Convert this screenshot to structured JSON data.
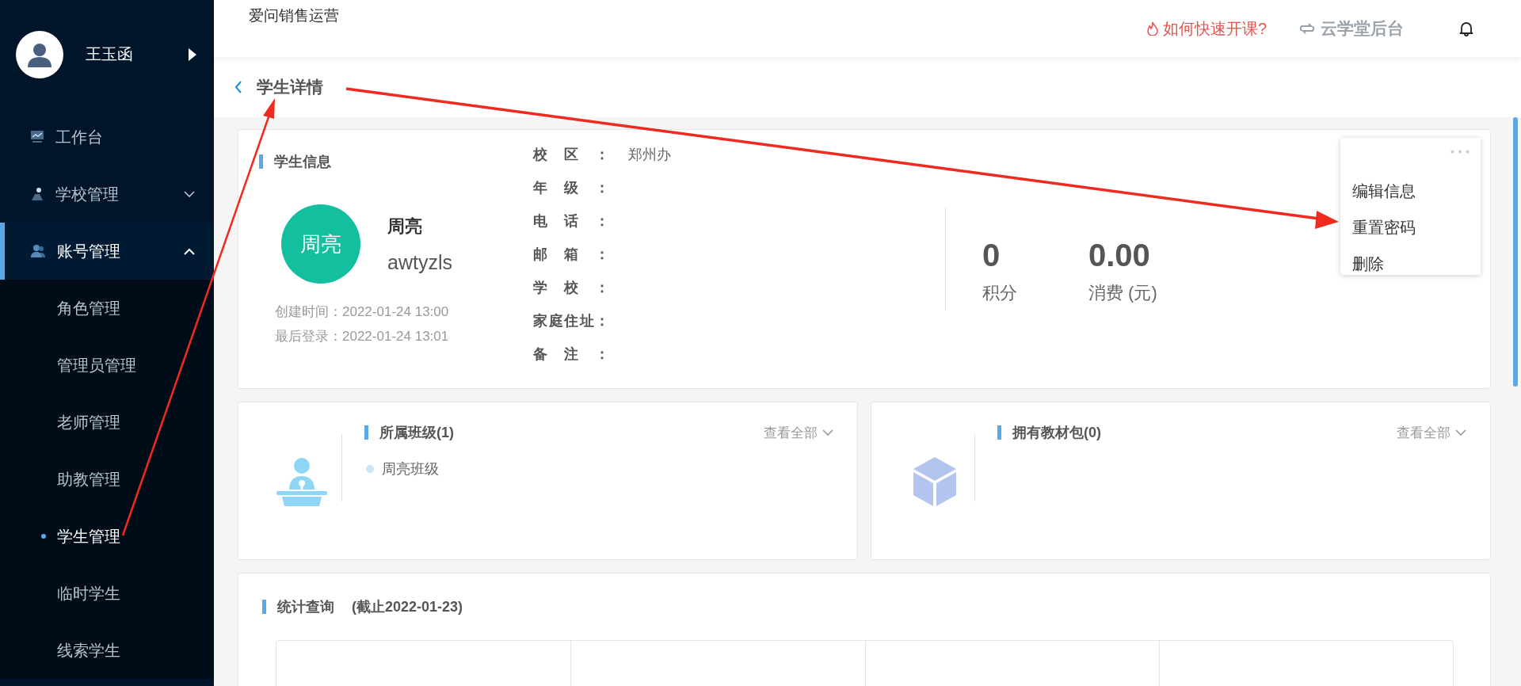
{
  "sidebar": {
    "user_name": "王玉函",
    "items": [
      {
        "label": "工作台",
        "selected": false
      },
      {
        "label": "学校管理",
        "selected": false,
        "expanded": false
      },
      {
        "label": "账号管理",
        "selected": true,
        "expanded": true,
        "children": [
          {
            "label": "角色管理",
            "selected": false
          },
          {
            "label": "管理员管理",
            "selected": false
          },
          {
            "label": "老师管理",
            "selected": false
          },
          {
            "label": "助教管理",
            "selected": false
          },
          {
            "label": "学生管理",
            "selected": true
          },
          {
            "label": "临时学生",
            "selected": false
          },
          {
            "label": "线索学生",
            "selected": false
          }
        ]
      }
    ]
  },
  "header": {
    "title": "爱问销售运营",
    "help_link": "如何快速开课?",
    "backend_link": "云学堂后台"
  },
  "page": {
    "title": "学生详情"
  },
  "student_info": {
    "section_title": "学生信息",
    "avatar_text": "周亮",
    "name": "周亮",
    "username": "awtyzls",
    "created": "创建时间：2022-01-24 13:00",
    "last_login": "最后登录：2022-01-24 13:01",
    "fields": [
      {
        "label": "校区：",
        "value": "郑州办"
      },
      {
        "label": "年级："
      },
      {
        "label": "电话："
      },
      {
        "label": "邮箱："
      },
      {
        "label": "学校："
      },
      {
        "label": "家庭住址："
      },
      {
        "label": "备注："
      }
    ],
    "stats": [
      {
        "value": "0",
        "label": "积分"
      },
      {
        "value": "0.00",
        "label": "消费 (元)"
      }
    ],
    "menu": [
      "编辑信息",
      "重置密码",
      "删除"
    ]
  },
  "classes": {
    "title": "所属班级(1)",
    "view_all": "查看全部",
    "items": [
      "周亮班级"
    ]
  },
  "materials": {
    "title": "拥有教材包(0)",
    "view_all": "查看全部"
  },
  "statistics": {
    "title": "统计查询",
    "subtitle": "(截止2022-01-23)"
  }
}
